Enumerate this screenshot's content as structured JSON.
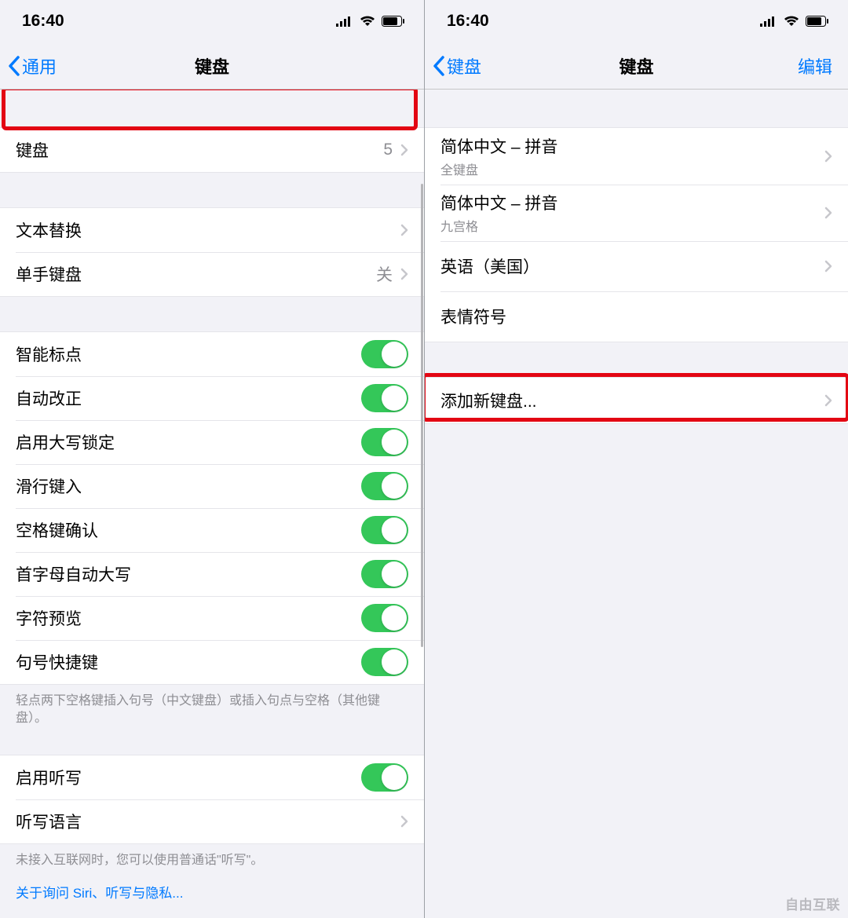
{
  "left": {
    "status": {
      "time": "16:40"
    },
    "nav": {
      "back": "通用",
      "title": "键盘"
    },
    "section1": {
      "keyboards": {
        "label": "键盘",
        "value": "5"
      }
    },
    "section2": {
      "text_replacement": {
        "label": "文本替换"
      },
      "one_handed": {
        "label": "单手键盘",
        "value": "关"
      }
    },
    "section3": {
      "smart_punct": {
        "label": "智能标点"
      },
      "auto_correct": {
        "label": "自动改正"
      },
      "caps_lock": {
        "label": "启用大写锁定"
      },
      "slide_type": {
        "label": "滑行键入"
      },
      "space_confirm": {
        "label": "空格键确认"
      },
      "first_caps": {
        "label": "首字母自动大写"
      },
      "char_preview": {
        "label": "字符预览"
      },
      "period_shortcut": {
        "label": "句号快捷键"
      },
      "footer": "轻点两下空格键插入句号（中文键盘）或插入句点与空格（其他键盘）。"
    },
    "section4": {
      "enable_dictation": {
        "label": "启用听写"
      },
      "dictation_lang": {
        "label": "听写语言"
      },
      "footer": "未接入互联网时，您可以使用普通话\"听写\"。",
      "link": "关于询问 Siri、听写与隐私..."
    }
  },
  "right": {
    "status": {
      "time": "16:40"
    },
    "nav": {
      "back": "键盘",
      "title": "键盘",
      "edit": "编辑"
    },
    "keyboards": [
      {
        "label": "简体中文 – 拼音",
        "sub": "全键盘"
      },
      {
        "label": "简体中文 – 拼音",
        "sub": "九宫格"
      },
      {
        "label": "英语（美国）",
        "sub": ""
      },
      {
        "label": "表情符号",
        "sub": ""
      }
    ],
    "add": {
      "label": "添加新键盘..."
    }
  },
  "watermark": "自由互联"
}
